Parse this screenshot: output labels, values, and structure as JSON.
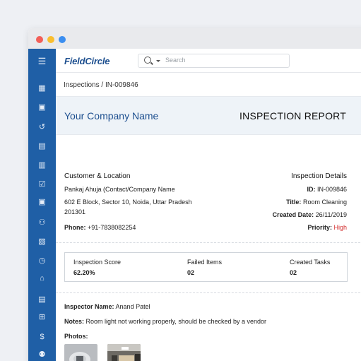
{
  "window": {
    "dot_colors": [
      "#f25f58",
      "#f9be2e",
      "#3b8ef0"
    ]
  },
  "sidebar": {
    "items": [
      {
        "icon": "menu-icon",
        "glyph": "☰"
      },
      {
        "icon": "dashboard-icon",
        "glyph": "▦"
      },
      {
        "icon": "calendar-icon",
        "glyph": "▣"
      },
      {
        "icon": "history-icon",
        "glyph": "↺"
      },
      {
        "icon": "clipboard-icon",
        "glyph": "▤"
      },
      {
        "icon": "document-settings-icon",
        "glyph": "▥"
      },
      {
        "icon": "checkbox-icon",
        "glyph": "☑"
      },
      {
        "icon": "schedule-icon",
        "glyph": "▣"
      },
      {
        "icon": "user-assign-icon",
        "glyph": "⚇"
      },
      {
        "icon": "inspection-icon",
        "glyph": "▧"
      },
      {
        "icon": "clock-icon",
        "glyph": "◷"
      },
      {
        "icon": "inventory-icon",
        "glyph": "⌂"
      },
      {
        "icon": "checklist-icon",
        "glyph": "▤"
      },
      {
        "icon": "hierarchy-icon",
        "glyph": "⊞"
      },
      {
        "icon": "dollar-icon",
        "glyph": "$"
      },
      {
        "icon": "users-icon",
        "glyph": "⚉"
      }
    ]
  },
  "header": {
    "logo": "FieldCircle",
    "search_placeholder": "Search"
  },
  "breadcrumb": {
    "parent": "Inspections",
    "separator": " / ",
    "current": "IN-009846"
  },
  "report": {
    "company_name": "Your Company Name",
    "title": "INSPECTION REPORT",
    "customer": {
      "heading": "Customer & Location",
      "contact": "Pankaj Ahuja (Contact/Company Name",
      "address_line1": "602 E Block, Sector 10, Noida, Uttar Pradesh",
      "address_line2": "201301",
      "phone_label": "Phone:",
      "phone": "+91-7838082254"
    },
    "details": {
      "heading": "Inspection Details",
      "id_label": "ID:",
      "id": "IN-009846",
      "title_label": "Title:",
      "title": "Room Cleaning",
      "created_label": "Created Date:",
      "created": "26/11/2019",
      "priority_label": "Priority:",
      "priority": "High",
      "priority_color": "#d32f2f"
    },
    "stats": [
      {
        "label": "Inspection Score",
        "value": "62.20%"
      },
      {
        "label": "Failed Items",
        "value": "02"
      },
      {
        "label": "Created Tasks",
        "value": "02"
      }
    ],
    "inspector_label": "Inspector Name:",
    "inspector": "Anand Patel",
    "notes_label": "Notes:",
    "notes": "Room light not working properly, should be checked by a vendor",
    "photos_label": "Photos:"
  }
}
